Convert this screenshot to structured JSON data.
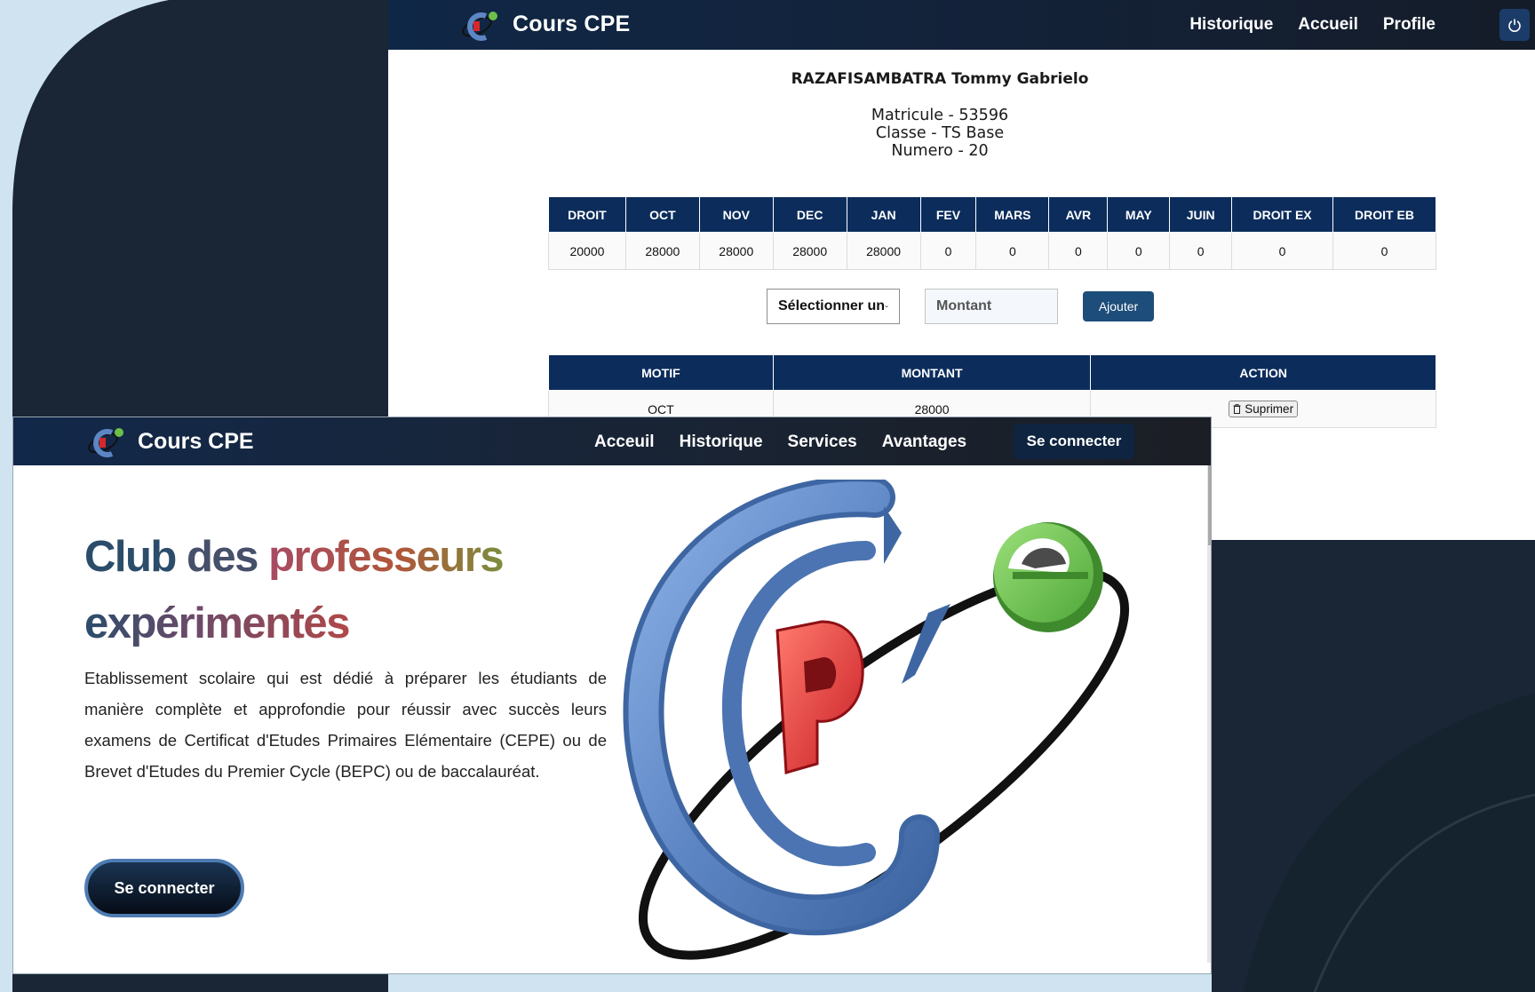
{
  "back_page": {
    "brand": "Cours CPE",
    "nav": [
      "Historique",
      "Accueil",
      "Profile"
    ],
    "student": {
      "name": "RAZAFISAMBATRA Tommy Gabrielo",
      "matricule": "Matricule - 53596",
      "classe": "Classe - TS Base",
      "numero": "Numero - 20"
    },
    "fees_table": {
      "headers": [
        "DROIT",
        "OCT",
        "NOV",
        "DEC",
        "JAN",
        "FEV",
        "MARS",
        "AVR",
        "MAY",
        "JUIN",
        "DROIT EX",
        "DROIT EB"
      ],
      "values": [
        "20000",
        "28000",
        "28000",
        "28000",
        "28000",
        "0",
        "0",
        "0",
        "0",
        "0",
        "0",
        "0"
      ]
    },
    "payment_form": {
      "select_value": "Sélectionner un",
      "amount_placeholder": "Montant",
      "submit_label": "Ajouter"
    },
    "history_table": {
      "headers": [
        "MOTIF",
        "MONTANT",
        "ACTION"
      ],
      "rows": [
        {
          "motif": "OCT",
          "montant": "28000",
          "action": "Suprimer"
        }
      ]
    }
  },
  "front_page": {
    "brand": "Cours CPE",
    "nav": [
      "Acceuil",
      "Historique",
      "Services",
      "Avantages"
    ],
    "login_label": "Se connecter",
    "hero": {
      "title_words": [
        "Club",
        "des",
        "professeurs",
        "expérimentés"
      ],
      "description": "Etablissement scolaire qui est dédié à préparer les étudiants de manière complète et approfondie pour réussir avec succès leurs examens de Certificat d'Etudes Primaires Elémentaire (CEPE) ou de Brevet d'Etudes du Premier Cycle (BEPC) ou de baccalauréat.",
      "cta_label": "Se connecter"
    }
  },
  "colors": {
    "navy": "#0c2d5c",
    "dark_bg": "#1a2636",
    "light_bg": "#cfe3f0",
    "logo_blue": "#5d86c4",
    "logo_red": "#d6282b",
    "logo_green": "#6cc04a"
  },
  "icons": [
    "cpe-logo-icon",
    "power-icon",
    "chevron-down-icon",
    "trash-icon"
  ]
}
